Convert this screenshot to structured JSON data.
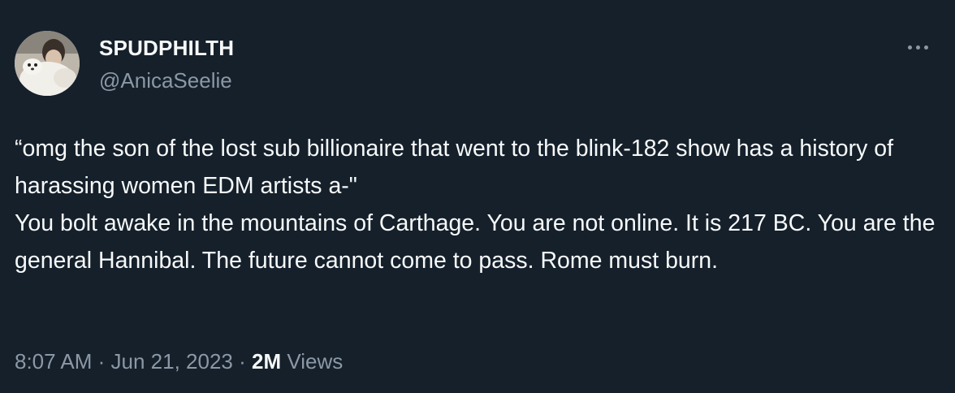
{
  "user": {
    "display_name": "SPUDPHILTH",
    "handle": "@AnicaSeelie",
    "avatar_icon": "profile-photo"
  },
  "more_icon": "ellipsis-icon",
  "tweet": {
    "line1": "“omg the son of the lost sub billionaire that went to the blink-182 show has a history of harassing women EDM artists a-\"",
    "line2": "You bolt awake in the mountains of Carthage. You are not online. It is 217 BC. You are the general Hannibal. The future cannot come to pass. Rome must burn."
  },
  "meta": {
    "time": "8:07 AM",
    "separator1": " · ",
    "date": "Jun 21, 2023",
    "separator2": " · ",
    "views_count": "2M",
    "views_label": " Views"
  },
  "colors": {
    "background": "#15202b",
    "text": "#f7f9f9",
    "secondary": "#8b98a5"
  }
}
